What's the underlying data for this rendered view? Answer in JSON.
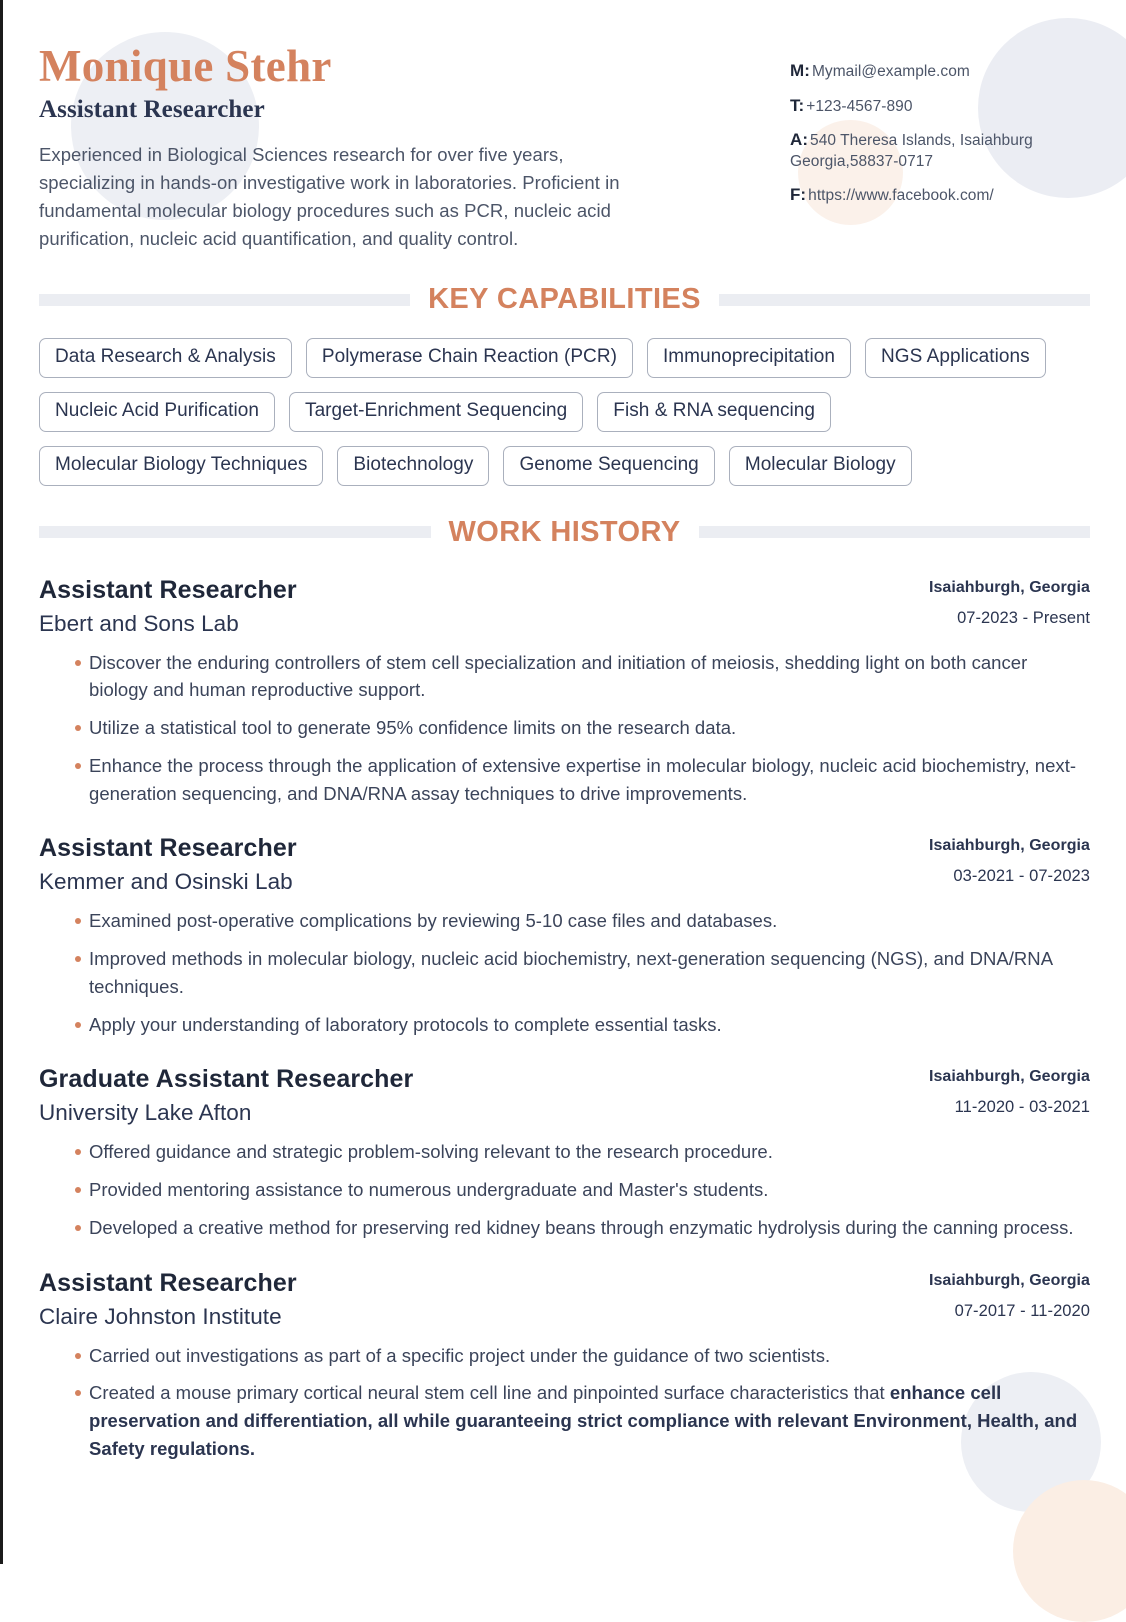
{
  "colors": {
    "accent": "#d4825e",
    "text_dark": "#2b3550",
    "text_body": "#4c5568",
    "divider": "#ebedf2",
    "pill_border": "#aab0bd",
    "deco_blue": "#edeff4",
    "deco_peach": "#fbf1ea"
  },
  "header": {
    "name": "Monique Stehr",
    "job_title": "Assistant Researcher",
    "summary": "Experienced in Biological Sciences research for over five years, specializing in hands-on investigative work in laboratories. Proficient in fundamental molecular biology procedures such as PCR, nucleic acid purification, nucleic acid quantification, and quality control."
  },
  "contact": {
    "items": [
      {
        "key": "M:",
        "value": "Mymail@example.com"
      },
      {
        "key": "T:",
        "value": "+123-4567-890"
      },
      {
        "key": "A:",
        "value": "540 Theresa Islands, Isaiahburg Georgia,58837-0717"
      },
      {
        "key": "F:",
        "value": "https://www.facebook.com/"
      }
    ]
  },
  "sections": {
    "key_capabilities": {
      "title": "KEY CAPABILITIES",
      "skills": [
        "Data Research & Analysis",
        "Polymerase Chain Reaction (PCR)",
        "Immunoprecipitation",
        "NGS Applications",
        "Nucleic Acid Purification",
        "Target-Enrichment Sequencing",
        "Fish & RNA sequencing",
        "Molecular Biology Techniques",
        "Biotechnology",
        "Genome Sequencing",
        "Molecular Biology"
      ]
    },
    "work_history": {
      "title": "WORK HISTORY",
      "jobs": [
        {
          "role": "Assistant Researcher",
          "company": "Ebert and Sons Lab",
          "location": "Isaiahburgh, Georgia",
          "dates": "07-2023 - Present",
          "bullets": [
            "Discover the enduring controllers of stem cell specialization and initiation of meiosis, shedding light on both cancer biology and human reproductive support.",
            "Utilize a statistical tool to generate 95% confidence limits on the research data.",
            "Enhance the process through the application of extensive expertise in molecular biology, nucleic acid biochemistry, next-generation sequencing, and DNA/RNA assay techniques to drive improvements."
          ]
        },
        {
          "role": "Assistant Researcher",
          "company": "Kemmer and Osinski Lab",
          "location": "Isaiahburgh, Georgia",
          "dates": "03-2021 - 07-2023",
          "bullets": [
            "Examined post-operative complications by reviewing 5-10 case files and databases.",
            "Improved methods in molecular biology, nucleic acid biochemistry, next-generation sequencing (NGS), and DNA/RNA techniques.",
            "Apply your understanding of laboratory protocols to complete essential tasks."
          ]
        },
        {
          "role": "Graduate Assistant Researcher",
          "company": "University Lake Afton",
          "location": "Isaiahburgh, Georgia",
          "dates": "11-2020 - 03-2021",
          "bullets": [
            "Offered guidance and strategic problem-solving relevant to the research procedure.",
            "Provided mentoring assistance to numerous undergraduate and Master's students.",
            "Developed a creative method for preserving red kidney beans through enzymatic hydrolysis during the canning process."
          ]
        },
        {
          "role": "Assistant Researcher",
          "company": "Claire Johnston Institute",
          "location": "Isaiahburgh, Georgia",
          "dates": "07-2017 - 11-2020",
          "bullets": [
            "Carried out investigations as part of a specific project under the guidance of two scientists.",
            "Created a mouse primary cortical neural stem cell line and pinpointed surface characteristics that enhance cell preservation and differentiation, all while guaranteeing strict compliance with relevant Environment, Health, and Safety regulations."
          ],
          "bullets_bold_tail": {
            "index": 1,
            "plain": "Created a mouse primary cortical neural stem cell line and pinpointed surface characteristics that ",
            "bold": "enhance cell preservation and differentiation, all while guaranteeing strict compliance with relevant Environment, Health, and Safety regulations."
          }
        }
      ]
    }
  }
}
